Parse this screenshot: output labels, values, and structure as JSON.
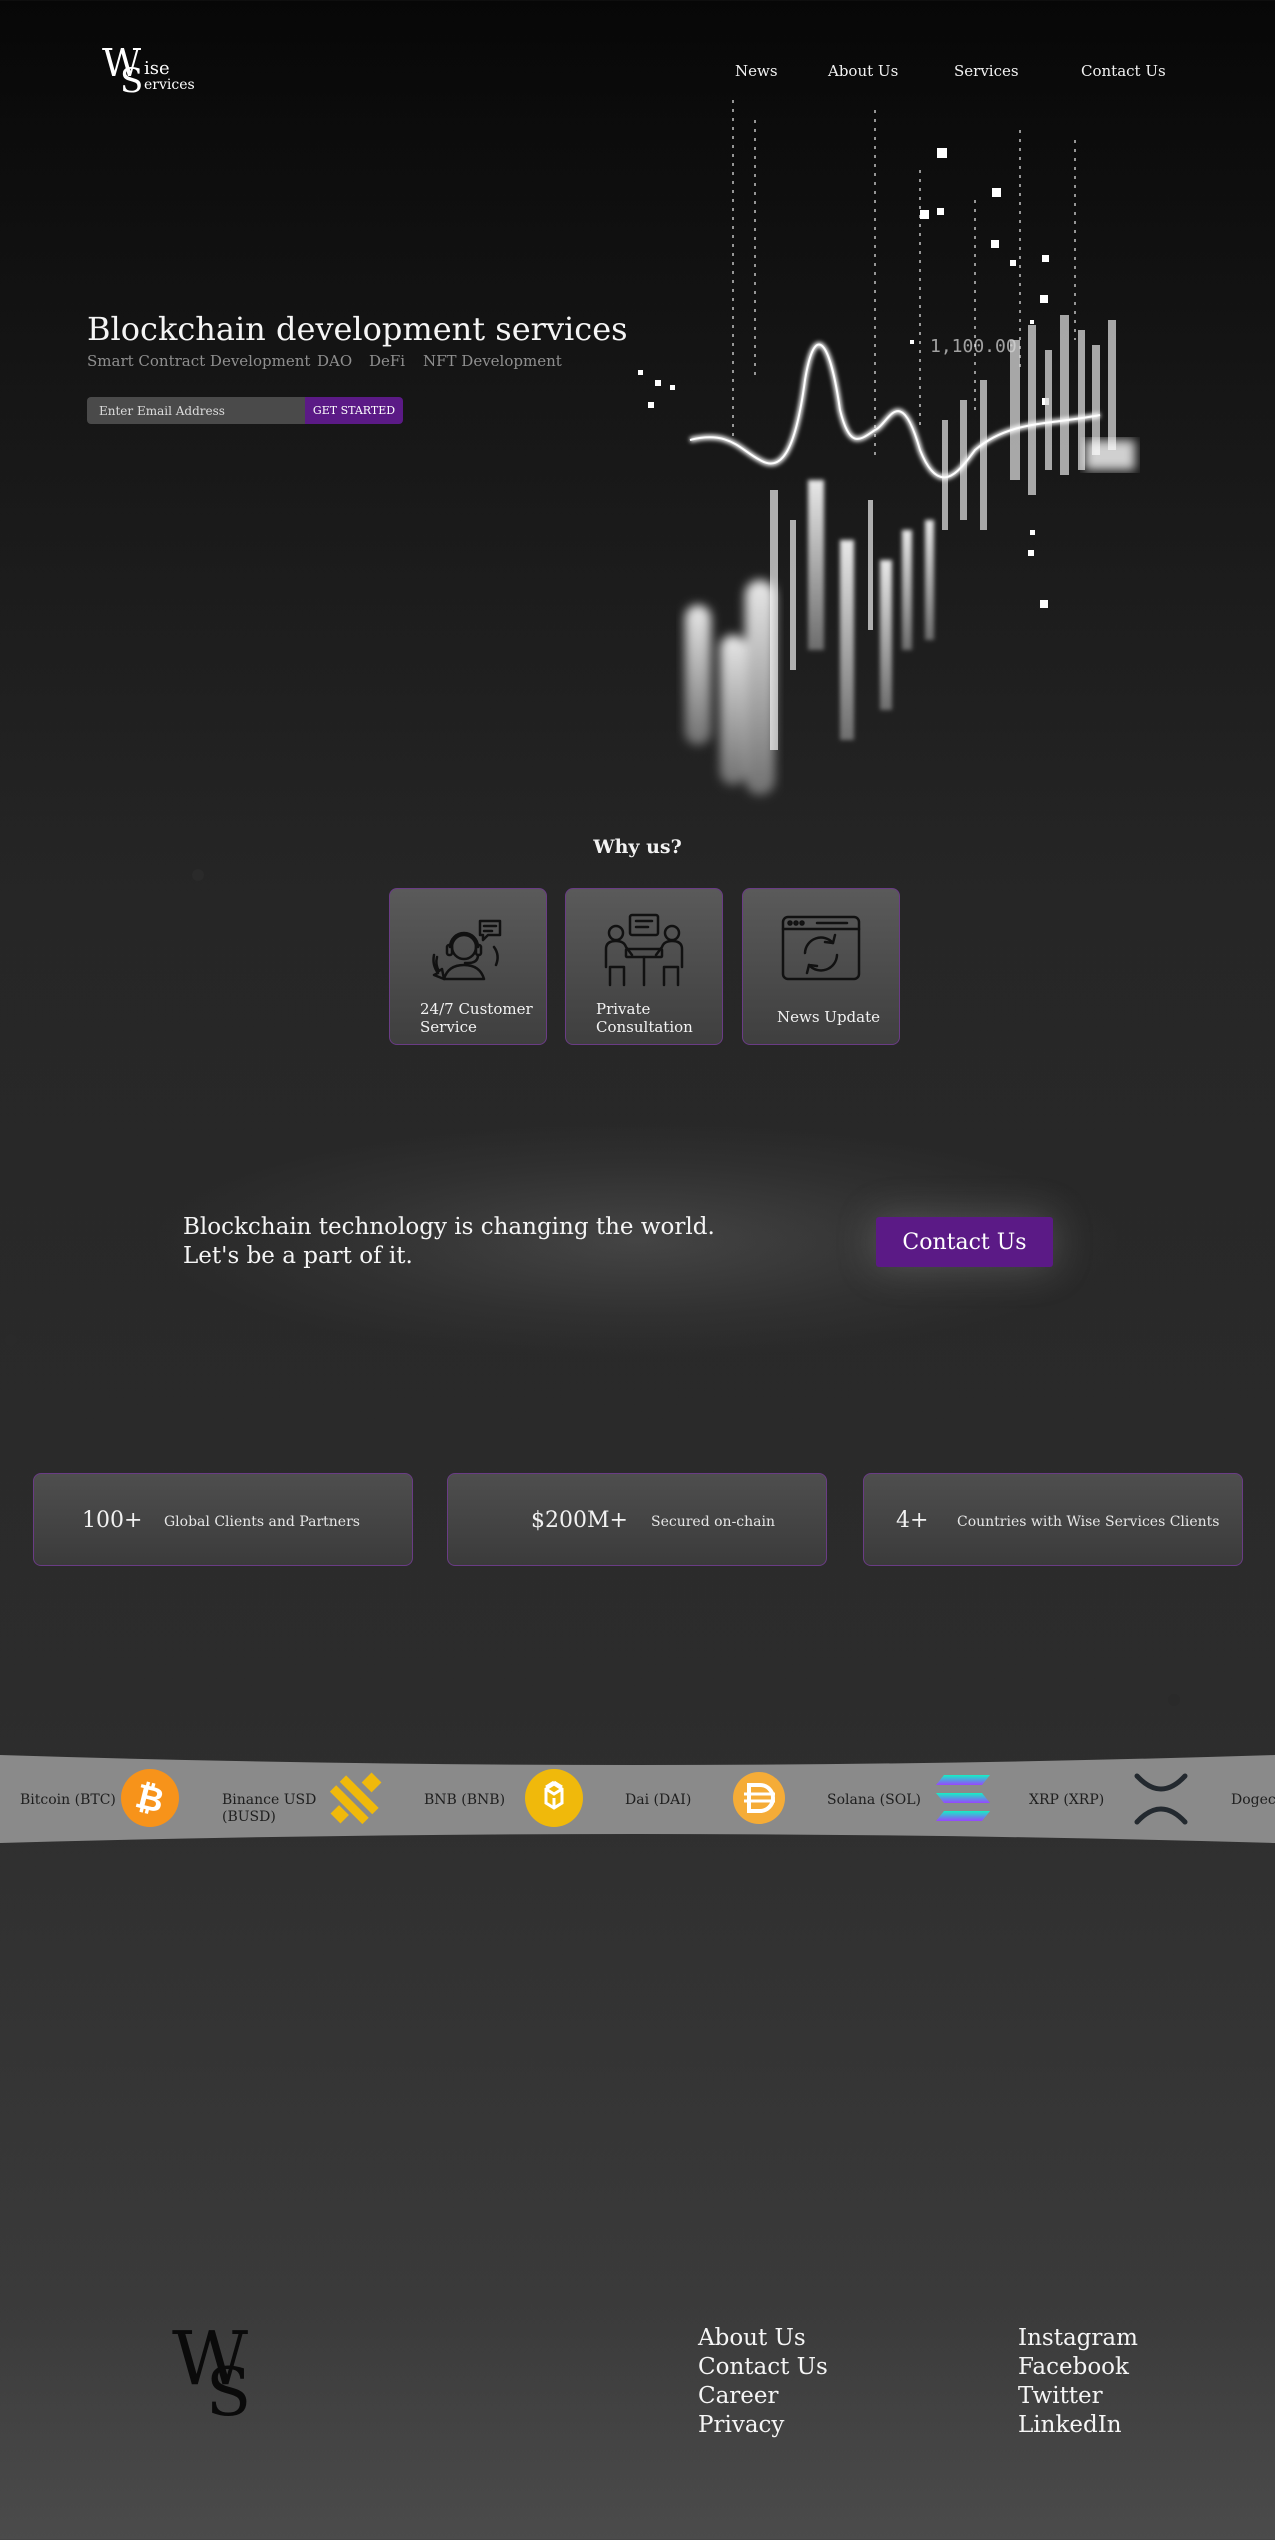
{
  "header": {
    "logo": {
      "w": "W",
      "s": "S",
      "line1": "ise",
      "line2": "ervices"
    },
    "nav": [
      "News",
      "About Us",
      "Services",
      "Contact Us"
    ]
  },
  "hero": {
    "title": "Blockchain development services",
    "subs": [
      "Smart Contract Development",
      "DAO",
      "DeFi",
      "NFT Development"
    ],
    "email_placeholder": "Enter Email Address",
    "cta": "GET STARTED"
  },
  "why": {
    "title": "Why us?",
    "cards": [
      {
        "label": "24/7 Customer Service",
        "icon": "headset-support-icon"
      },
      {
        "label": "Private Consultation",
        "icon": "meeting-consultation-icon"
      },
      {
        "label": "News Update",
        "icon": "browser-refresh-icon"
      }
    ]
  },
  "cta": {
    "line1": "Blockchain technology is changing the world.",
    "line2": "Let's be a part of it.",
    "button": "Contact Us"
  },
  "stats": [
    {
      "value": "100+",
      "label": "Global Clients and Partners"
    },
    {
      "value": "$200M+",
      "label": "Secured on-chain"
    },
    {
      "value": "4+",
      "label": "Countries with Wise Services  Clients"
    }
  ],
  "ticker": [
    {
      "name": "Bitcoin (BTC)",
      "icon": "bitcoin-icon",
      "color": "#f7931a"
    },
    {
      "name": "Binance USD (BUSD)",
      "icon": "busd-icon",
      "color": "#f0b90b"
    },
    {
      "name": "BNB (BNB)",
      "icon": "bnb-icon",
      "color": "#f0b90b"
    },
    {
      "name": "Dai (DAI)",
      "icon": "dai-icon",
      "color": "#f5ac37"
    },
    {
      "name": "Solana (SOL)",
      "icon": "solana-icon",
      "color": "#9945ff"
    },
    {
      "name": "XRP (XRP)",
      "icon": "xrp-icon",
      "color": "#23292f"
    },
    {
      "name": "Dogec",
      "icon": "",
      "color": ""
    }
  ],
  "footer": {
    "logo": {
      "w": "W",
      "s": "S"
    },
    "col1": [
      "About Us",
      "Contact Us",
      "Career",
      "Privacy"
    ],
    "col2": [
      "Instagram",
      "Facebook",
      "Twitter",
      "LinkedIn"
    ]
  }
}
